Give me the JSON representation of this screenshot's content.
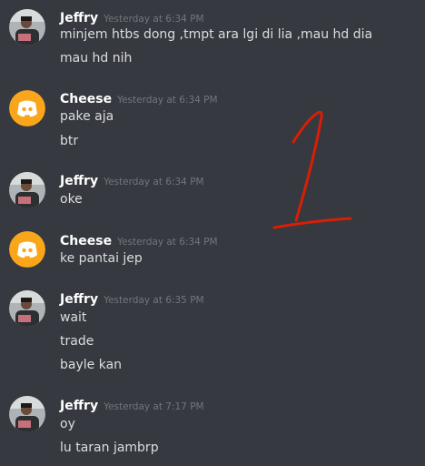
{
  "messages": [
    {
      "user": "Jeffry",
      "avatar": "user-photo",
      "time": "Yesterday at 6:34 PM",
      "lines": [
        "minjem htbs dong ,tmpt ara lgi di lia ,mau hd dia",
        "mau hd nih"
      ]
    },
    {
      "user": "Cheese",
      "avatar": "discord-logo",
      "time": "Yesterday at 6:34 PM",
      "lines": [
        "pake aja",
        "btr"
      ]
    },
    {
      "user": "Jeffry",
      "avatar": "user-photo",
      "time": "Yesterday at 6:34 PM",
      "lines": [
        "oke"
      ]
    },
    {
      "user": "Cheese",
      "avatar": "discord-logo",
      "time": "Yesterday at 6:34 PM",
      "lines": [
        "ke pantai jep"
      ]
    },
    {
      "user": "Jeffry",
      "avatar": "user-photo",
      "time": "Yesterday at 6:35 PM",
      "lines": [
        "wait",
        "trade",
        "bayle kan"
      ]
    },
    {
      "user": "Jeffry",
      "avatar": "user-photo",
      "time": "Yesterday at 7:17 PM",
      "lines": [
        "oy",
        "lu taran jambrp"
      ]
    }
  ],
  "annotation": {
    "text": "1",
    "color": "#d81e05"
  },
  "colors": {
    "background": "#36393f",
    "username": "#ffffff",
    "timestamp": "#72767d",
    "message": "#dcddde",
    "discord_avatar_bg": "#faa61a"
  }
}
